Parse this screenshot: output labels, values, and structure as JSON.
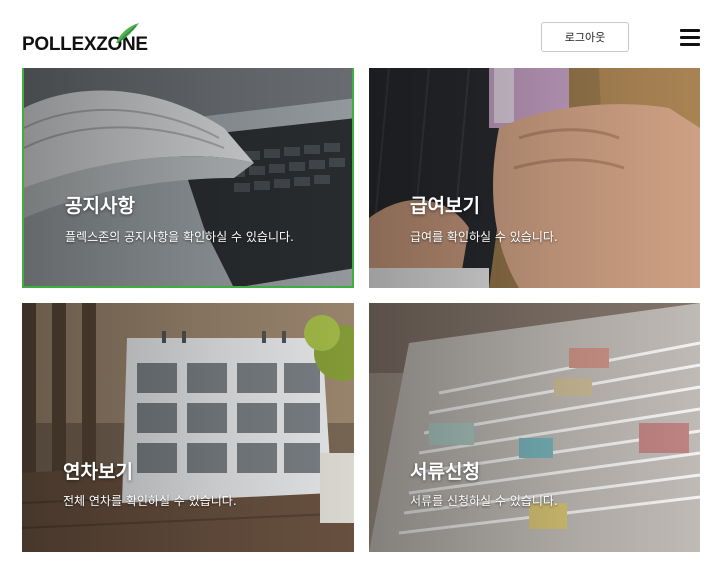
{
  "header": {
    "logo_text": "POLLEXZONE",
    "logout_label": "로그아웃",
    "menu_icon": "hamburger-menu-icon"
  },
  "cards": [
    {
      "title": "공지사항",
      "description": "플렉스존의 공지사항을 확인하실 수 있습니다.",
      "image": "newspaper-laptop-photo"
    },
    {
      "title": "급여보기",
      "description": "급여를 확인하실 수 있습니다.",
      "image": "money-envelope-photo"
    },
    {
      "title": "연차보기",
      "description": "전체 연차를 확인하실 수 있습니다.",
      "image": "desk-calendar-photo"
    },
    {
      "title": "서류신청",
      "description": "서류를 신청하실 수 있습니다.",
      "image": "paper-stack-photo"
    }
  ],
  "colors": {
    "accent": "#3fae3f",
    "logo_leaf": "#4caf50"
  }
}
